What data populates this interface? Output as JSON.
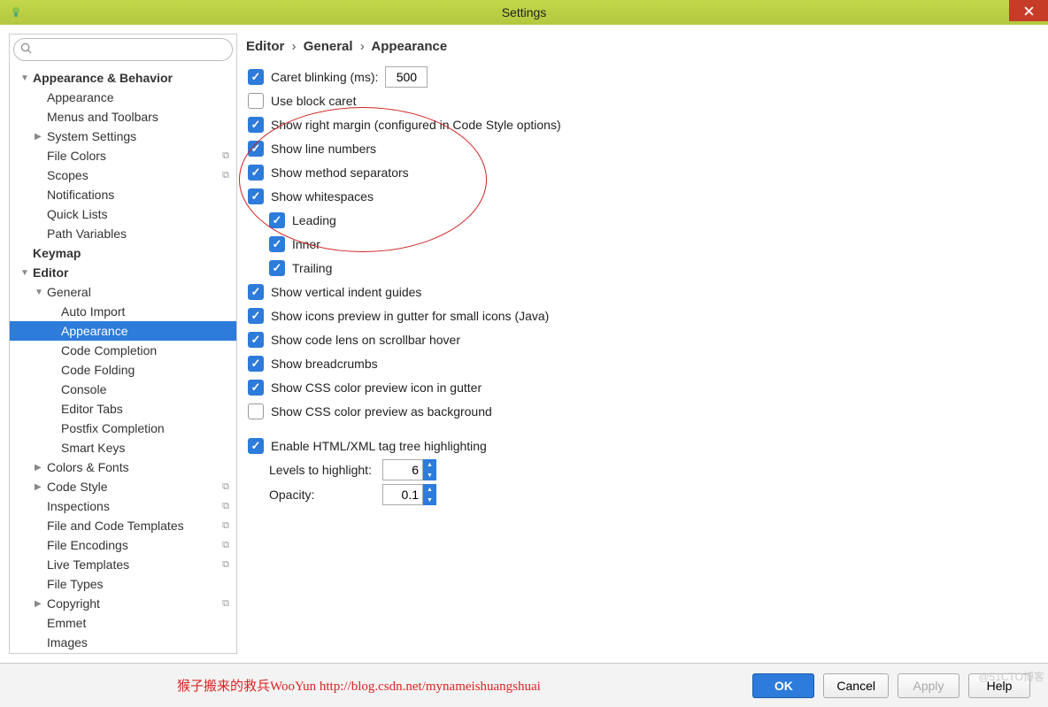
{
  "window": {
    "title": "Settings"
  },
  "breadcrumb": {
    "p1": "Editor",
    "p2": "General",
    "p3": "Appearance"
  },
  "sidebar": {
    "items": [
      {
        "label": "Appearance & Behavior",
        "bold": true,
        "arrow": "▼",
        "indent": 0
      },
      {
        "label": "Appearance",
        "indent": 1
      },
      {
        "label": "Menus and Toolbars",
        "indent": 1
      },
      {
        "label": "System Settings",
        "arrow": "▶",
        "indent": 1
      },
      {
        "label": "File Colors",
        "indent": 1,
        "copy": true
      },
      {
        "label": "Scopes",
        "indent": 1,
        "copy": true
      },
      {
        "label": "Notifications",
        "indent": 1
      },
      {
        "label": "Quick Lists",
        "indent": 1
      },
      {
        "label": "Path Variables",
        "indent": 1
      },
      {
        "label": "Keymap",
        "bold": true,
        "indent": 0
      },
      {
        "label": "Editor",
        "bold": true,
        "arrow": "▼",
        "indent": 0
      },
      {
        "label": "General",
        "arrow": "▼",
        "indent": 1
      },
      {
        "label": "Auto Import",
        "indent": 2
      },
      {
        "label": "Appearance",
        "indent": 2,
        "selected": true
      },
      {
        "label": "Code Completion",
        "indent": 2
      },
      {
        "label": "Code Folding",
        "indent": 2
      },
      {
        "label": "Console",
        "indent": 2
      },
      {
        "label": "Editor Tabs",
        "indent": 2
      },
      {
        "label": "Postfix Completion",
        "indent": 2
      },
      {
        "label": "Smart Keys",
        "indent": 2
      },
      {
        "label": "Colors & Fonts",
        "arrow": "▶",
        "indent": 1
      },
      {
        "label": "Code Style",
        "arrow": "▶",
        "indent": 1,
        "copy": true
      },
      {
        "label": "Inspections",
        "indent": 1,
        "copy": true
      },
      {
        "label": "File and Code Templates",
        "indent": 1,
        "copy": true
      },
      {
        "label": "File Encodings",
        "indent": 1,
        "copy": true
      },
      {
        "label": "Live Templates",
        "indent": 1,
        "copy": true
      },
      {
        "label": "File Types",
        "indent": 1
      },
      {
        "label": "Copyright",
        "arrow": "▶",
        "indent": 1,
        "copy": true
      },
      {
        "label": "Emmet",
        "indent": 1
      },
      {
        "label": "Images",
        "indent": 1
      }
    ]
  },
  "settings": {
    "caret_blinking": {
      "label": "Caret blinking (ms):",
      "checked": true,
      "value": "500"
    },
    "block_caret": {
      "label": "Use block caret",
      "checked": false
    },
    "right_margin": {
      "label": "Show right margin (configured in Code Style options)",
      "checked": true
    },
    "line_numbers": {
      "label": "Show line numbers",
      "checked": true
    },
    "method_sep": {
      "label": "Show method separators",
      "checked": true
    },
    "whitespaces": {
      "label": "Show whitespaces",
      "checked": true
    },
    "leading": {
      "label": "Leading",
      "checked": true
    },
    "inner": {
      "label": "Inner",
      "checked": true
    },
    "trailing": {
      "label": "Trailing",
      "checked": true
    },
    "vert_guides": {
      "label": "Show vertical indent guides",
      "checked": true
    },
    "icons_preview": {
      "label": "Show icons preview in gutter for small icons (Java)",
      "checked": true
    },
    "code_lens": {
      "label": "Show code lens on scrollbar hover",
      "checked": true
    },
    "breadcrumbs": {
      "label": "Show breadcrumbs",
      "checked": true
    },
    "css_gutter": {
      "label": "Show CSS color preview icon in gutter",
      "checked": true
    },
    "css_bg": {
      "label": "Show CSS color preview as background",
      "checked": false
    },
    "html_tree": {
      "label": "Enable HTML/XML tag tree highlighting",
      "checked": true
    },
    "levels": {
      "label": "Levels to highlight:",
      "value": "6"
    },
    "opacity": {
      "label": "Opacity:",
      "value": "0.1"
    }
  },
  "footer": {
    "watermark": "猴子搬来的救兵WooYun http://blog.csdn.net/mynameishuangshuai",
    "ok": "OK",
    "cancel": "Cancel",
    "apply": "Apply",
    "help": "Help"
  },
  "corner_watermark": "@51CTO博客"
}
